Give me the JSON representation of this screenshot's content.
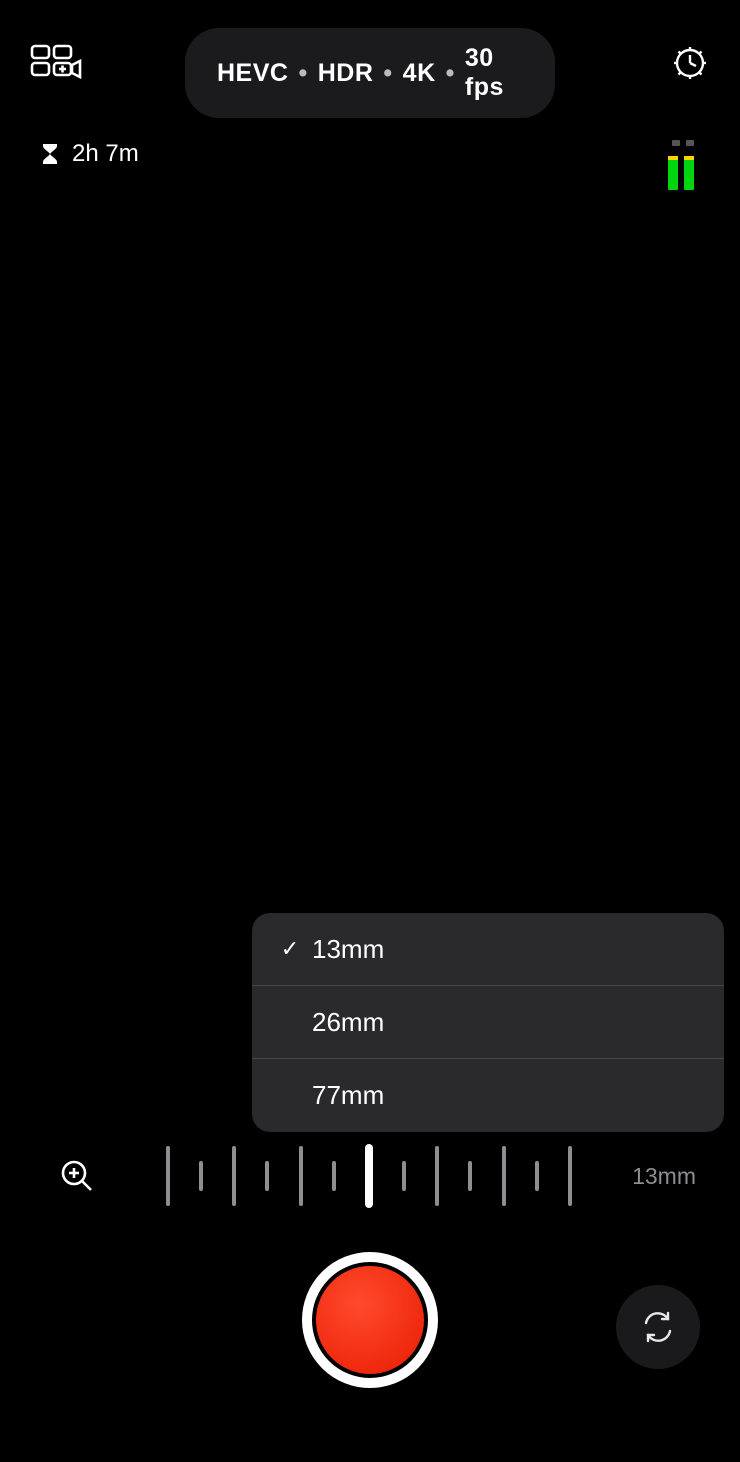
{
  "header": {
    "format_codec": "HEVC",
    "format_hdr": "HDR",
    "format_res": "4K",
    "format_fps": "30 fps"
  },
  "status": {
    "remaining_time": "2h 7m"
  },
  "lens": {
    "items": [
      {
        "label": "13mm",
        "selected": true
      },
      {
        "label": "26mm",
        "selected": false
      },
      {
        "label": "77mm",
        "selected": false
      }
    ],
    "current_label": "13mm"
  }
}
